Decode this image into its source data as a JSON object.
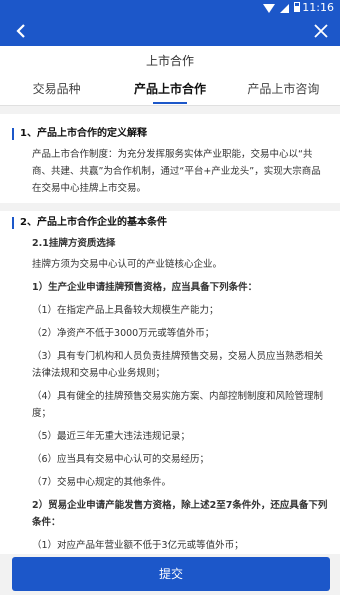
{
  "status_bar": {
    "time": "11:16"
  },
  "header": {
    "title": "上市合作"
  },
  "tabs": [
    {
      "label": "交易品种"
    },
    {
      "label": "产品上市合作"
    },
    {
      "label": "产品上市咨询"
    }
  ],
  "section1": {
    "title": "1、产品上市合作的定义解释",
    "body": "产品上市合作制度：为充分发挥服务实体产业职能，交易中心以“共商、共建、共赢”为合作机制，通过“平台+产业龙头”，实现大宗商品在交易中心挂牌上市交易。"
  },
  "section2": {
    "title": "2、产品上市合作企业的基本条件",
    "sub": "2.1挂牌方资质选择",
    "intro": "挂牌方须为交易中心认可的产业链核心企业。",
    "part1_title": "1）生产企业申请挂牌预售资格，应当具备下列条件：",
    "part1_items": [
      "（1）在指定产品上具备较大规模生产能力；",
      "（2）净资产不低于3000万元或等值外币；",
      "（3）具有专门机构和人员负责挂牌预售交易，交易人员应当熟悉相关法律法规和交易中心业务规则；",
      "（4）具有健全的挂牌预售交易实施方案、内部控制制度和风险管理制度；",
      "（5）最近三年无重大违法违规记录；",
      "（6）应当具有交易中心认可的交易经历；",
      "（7）交易中心规定的其他条件。"
    ],
    "part2_title": "2）贸易企业申请产能发售方资格，除上述2至7条件外，还应具备下列条件：",
    "part2_items": [
      "（1）对应产品年营业额不低于3亿元或等值外币；"
    ]
  },
  "footer": {
    "submit_label": "提交"
  }
}
